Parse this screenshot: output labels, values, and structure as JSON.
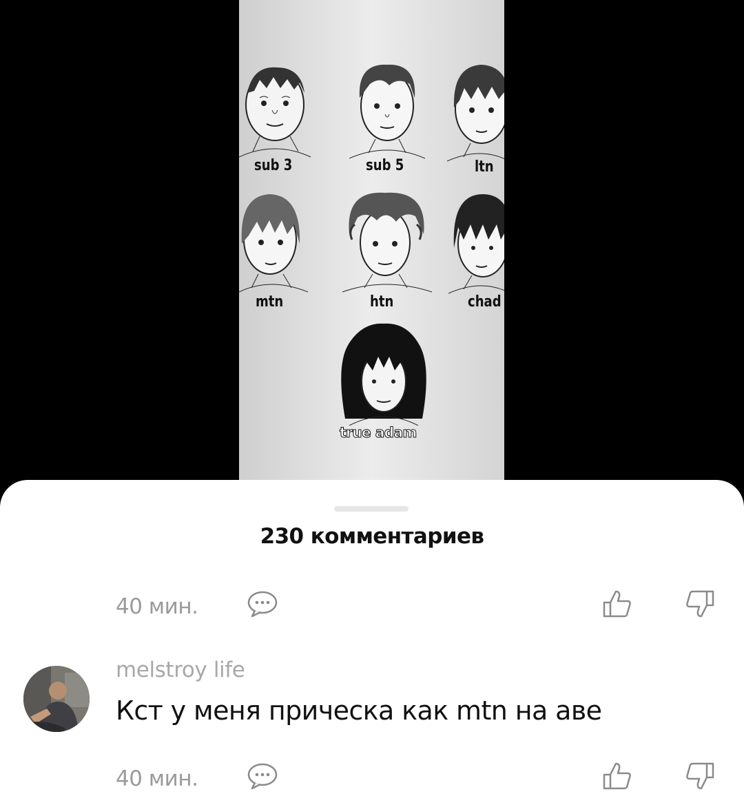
{
  "video": {
    "faces": [
      {
        "label": "sub 3",
        "hair": "messy"
      },
      {
        "label": "sub 5",
        "hair": "short"
      },
      {
        "label": "ltn",
        "hair": "bowl"
      },
      {
        "label": "mtn",
        "hair": "fringe"
      },
      {
        "label": "htn",
        "hair": "fluffy"
      },
      {
        "label": "chad",
        "hair": "dark-fringe"
      },
      {
        "label": "true adam",
        "hair": "long-black"
      }
    ]
  },
  "sheet": {
    "comment_count": "230 комментариев"
  },
  "comments": [
    {
      "time": "40 мин.",
      "reply_icon": "speech-bubble-icon",
      "like_icon": "thumbs-up-icon",
      "dislike_icon": "thumbs-down-icon"
    },
    {
      "username": "melstroy life",
      "text": "Кст у меня прическа как mtn на аве",
      "time": "40 мин.",
      "reply_icon": "speech-bubble-icon",
      "like_icon": "thumbs-up-icon",
      "dislike_icon": "thumbs-down-icon"
    }
  ],
  "colors": {
    "sheet_bg": "#ffffff",
    "meta_text": "#9a9a9a",
    "username_text": "#a8a8a8",
    "body_text": "#111111"
  }
}
